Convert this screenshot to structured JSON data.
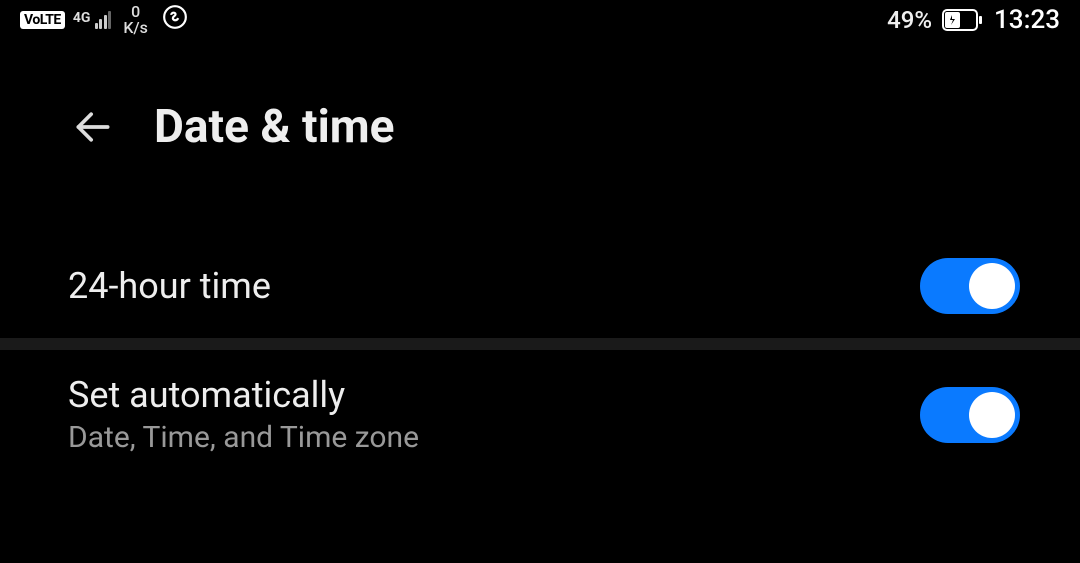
{
  "status": {
    "volte": "VoLTE",
    "network": "4G",
    "data_value": "0",
    "data_unit": "K/s",
    "battery_percent": "49%",
    "time": "13:23"
  },
  "header": {
    "title": "Date & time"
  },
  "settings": {
    "item1": {
      "title": "24-hour time",
      "enabled": true
    },
    "item2": {
      "title": "Set automatically",
      "subtitle": "Date, Time, and Time zone",
      "enabled": true
    }
  }
}
